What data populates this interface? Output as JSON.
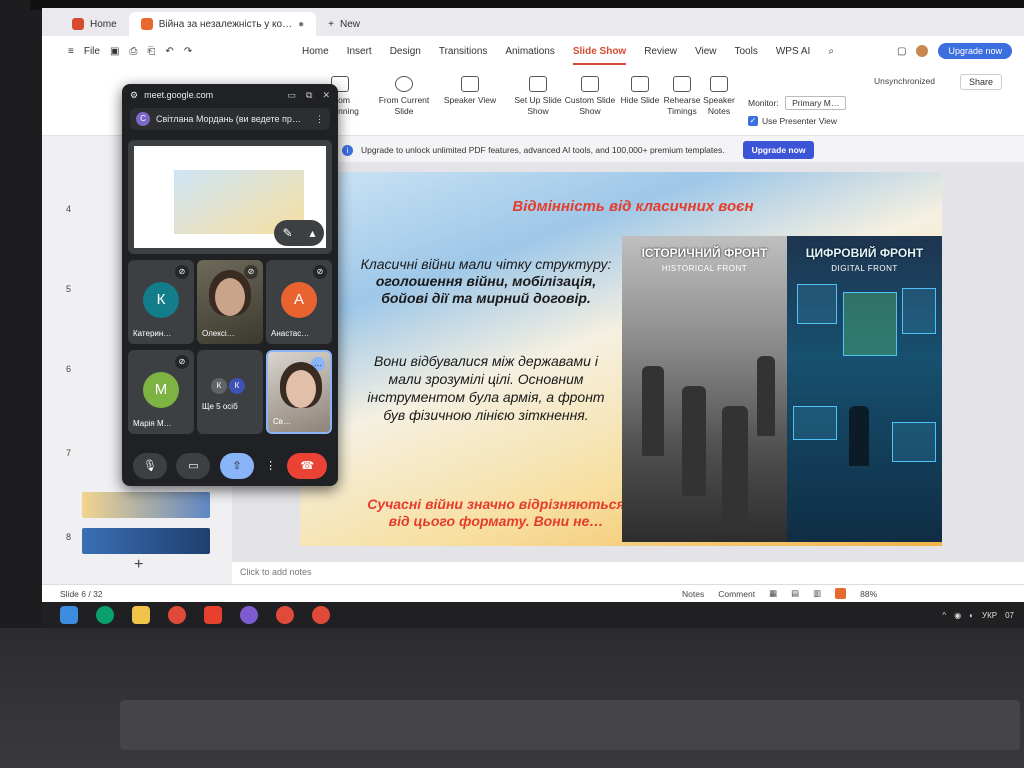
{
  "browser_tabs": [
    {
      "label": "Home",
      "badge_color": "#d64b2f"
    },
    {
      "label": "Війна за незалежність у ко…",
      "badge_color": "#e8692d"
    },
    {
      "label": "New",
      "badge_color": ""
    }
  ],
  "menu": {
    "file_label": "File",
    "tabs": [
      "Home",
      "Insert",
      "Design",
      "Transitions",
      "Animations",
      "Slide Show",
      "Review",
      "View",
      "Tools",
      "WPS AI"
    ],
    "active_tab": "Slide Show",
    "upgrade_label": "Upgrade now",
    "unsynchronized": "Unsynchronized",
    "share": "Share"
  },
  "toolbar": {
    "from_beginning": "From Beginning",
    "from_current": "From Current Slide",
    "speaker_view": "Speaker View",
    "set_up": "Set Up Slide Show",
    "custom": "Custom Slide Show",
    "hide_slide": "Hide Slide",
    "rehearse": "Rehearse Timings",
    "speaker_notes": "Speaker Notes",
    "monitor_label": "Monitor:",
    "monitor_value": "Primary M…",
    "use_presenter": "Use Presenter View"
  },
  "promo": {
    "text": "Upgrade to unlock unlimited PDF features, advanced AI tools, and 100,000+ premium templates.",
    "button": "Upgrade now"
  },
  "thumbnails": {
    "numbers": [
      "4",
      "5",
      "6",
      "7",
      "8"
    ]
  },
  "slide": {
    "title": "Відмінність від класичних воєн",
    "para1_prefix": "Класичні війни мали чітку структуру: ",
    "para1_bold": "оголошення війни, мобілізація, бойові дії та мирний договір.",
    "para2": "Вони відбувалися між державами і мали зрозумілі цілі. Основним інструментом була армія, а фронт був фізичною лінією зіткнення.",
    "para3": "Сучасні війни значно відрізняються від цього формату. Вони не…",
    "image_left_title": "ІСТОРИЧНИЙ ФРОНТ",
    "image_left_sub": "HISTORICAL FRONT",
    "image_right_title": "ЦИФРОВИЙ ФРОНТ",
    "image_right_sub": "DIGITAL FRONT"
  },
  "notes_placeholder": "Click to add notes",
  "status": {
    "slide_counter": "Slide 6 / 32",
    "notes": "Notes",
    "comment": "Comment",
    "zoom": "88%"
  },
  "meet": {
    "url": "meet.google.com",
    "presenter": "Світлана Мордань (ви ведете пр…",
    "presenter_initial": "С",
    "participants": [
      {
        "name": "Катерин…",
        "initial": "К",
        "color": "#137d8a"
      },
      {
        "name": "Олексі…",
        "initial": "",
        "color": ""
      },
      {
        "name": "Анастас…",
        "initial": "А",
        "color": "#e8632f"
      },
      {
        "name": "Марія М…",
        "initial": "М",
        "color": "#7cb342"
      },
      {
        "name": "Ще 5 осіб",
        "initial": "",
        "color": ""
      },
      {
        "name": "Св…",
        "initial": "",
        "color": ""
      }
    ],
    "more_initials": [
      "К",
      "К"
    ]
  },
  "taskbar": {
    "lang": "УКР",
    "clock": "07"
  }
}
